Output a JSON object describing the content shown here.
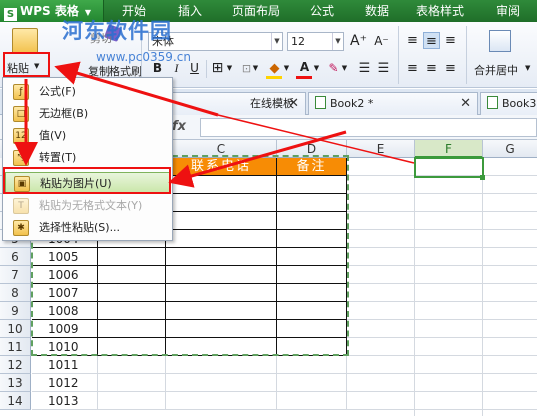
{
  "app": {
    "title": "WPS 表格",
    "logo": "S"
  },
  "menubar": [
    "开始",
    "插入",
    "页面布局",
    "公式",
    "数据",
    "表格样式",
    "审阅"
  ],
  "watermark": {
    "title": "河东软件园",
    "url": "www.pc0359.cn"
  },
  "ribbon": {
    "paste_label": "粘贴",
    "cut_label": "剪切",
    "copy_label": "复制",
    "format_painter_label": "格式刷",
    "font_name": "宋体",
    "font_size": "12",
    "grow_font": "A⁺",
    "shrink_font": "A⁻",
    "bold": "B",
    "italic": "I",
    "underline": "U",
    "font_color_letter": "A",
    "merge_center_label": "合并居中"
  },
  "tabs": [
    {
      "label": "在线模板",
      "close": "✕"
    },
    {
      "label": "Book2 *",
      "close": "✕"
    },
    {
      "label": "Book3",
      "close": ""
    }
  ],
  "formula_bar": {
    "fx": "fx",
    "value": ""
  },
  "columns": [
    "C",
    "D",
    "E",
    "F",
    "G"
  ],
  "rows": [
    "5",
    "6",
    "7",
    "8",
    "9",
    "10",
    "11",
    "12",
    "13",
    "14"
  ],
  "table": {
    "header": [
      "联系电话",
      "备注"
    ],
    "ids": [
      "1004",
      "1005",
      "1006",
      "1007",
      "1008",
      "1009",
      "1010",
      "1011",
      "1012",
      "1013"
    ]
  },
  "paste_menu": {
    "items": [
      {
        "label": "公式(F)",
        "icon": "fx-paste-icon",
        "enabled": true
      },
      {
        "label": "无边框(B)",
        "icon": "no-border-paste-icon",
        "enabled": true
      },
      {
        "label": "值(V)",
        "icon": "values-paste-icon",
        "enabled": true
      },
      {
        "label": "转置(T)",
        "icon": "transpose-paste-icon",
        "enabled": true
      },
      {
        "label": "粘贴为图片(U)",
        "icon": "picture-paste-icon",
        "enabled": true,
        "highlighted": true
      },
      {
        "label": "粘贴为无格式文本(Y)",
        "icon": "plain-text-paste-icon",
        "enabled": false
      },
      {
        "label": "选择性粘贴(S)...",
        "icon": "paste-special-icon",
        "enabled": true
      }
    ]
  },
  "colors": {
    "accent_green": "#2c8c36",
    "header_orange": "#f78c05",
    "annotation_red": "#e11"
  }
}
